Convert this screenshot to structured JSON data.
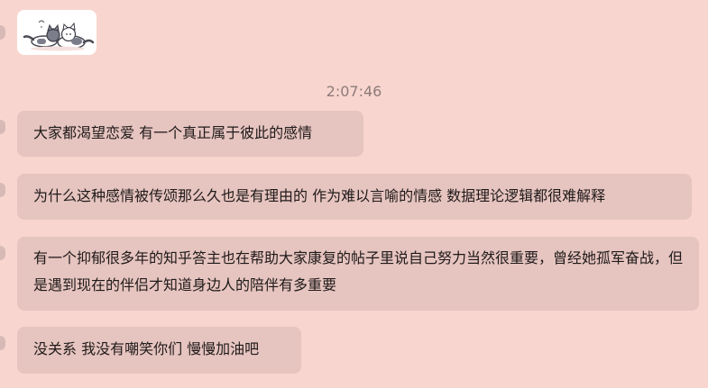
{
  "chat": {
    "timestamp": "2:07:46",
    "messages": [
      {
        "text": "大家都渴望恋爱 有一个真正属于彼此的感情"
      },
      {
        "text": "为什么这种感情被传颂那么久也是有理由的 作为难以言喻的情感 数据理论逻辑都很难解释"
      },
      {
        "text": "有一个抑郁很多年的知乎答主也在帮助大家康复的帖子里说自己努力当然很重要，曾经她孤军奋战，但是遇到现在的伴侣才知道身边人的陪伴有多重要"
      },
      {
        "text": "没关系 我没有嘲笑你们 慢慢加油吧"
      }
    ],
    "sticker": {
      "icon": "cat-sticker-icon"
    }
  },
  "colors": {
    "background": "#f8d6cf",
    "bubble": "#e6c4bf",
    "timestamp": "#8d7b79"
  }
}
